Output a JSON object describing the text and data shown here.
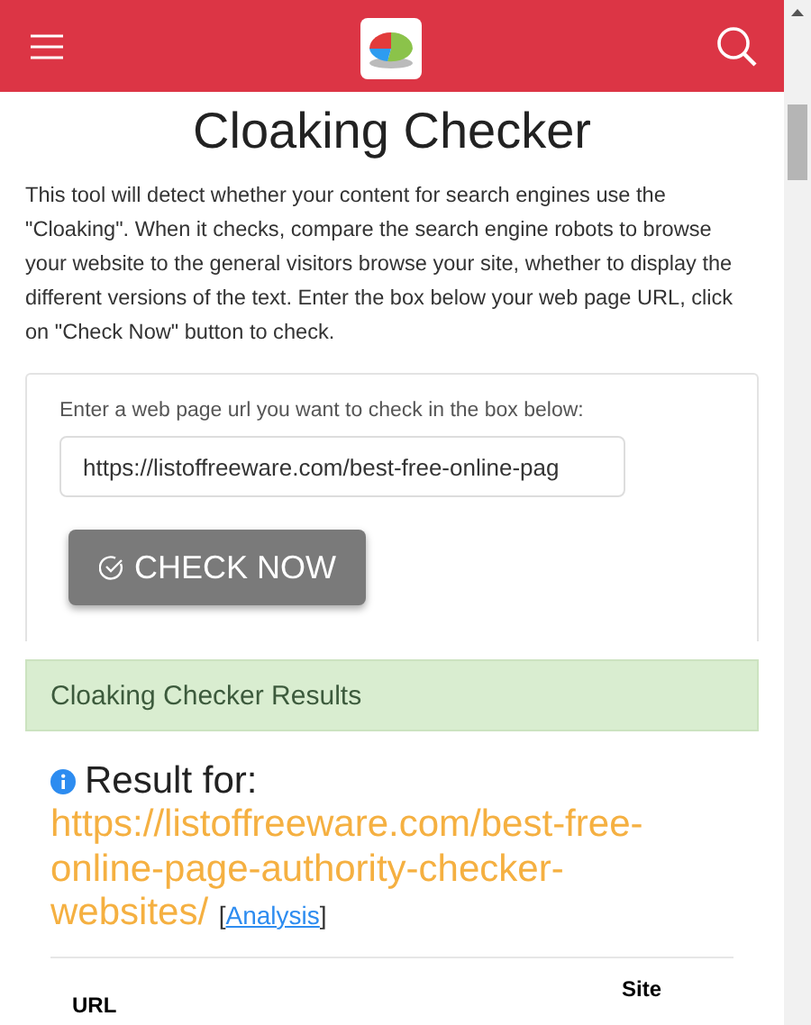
{
  "page_title": "Cloaking Checker",
  "intro": "This tool will detect whether your content for search engines use the \"Cloaking\". When it checks, compare the search engine robots to browse your website to the general visitors browse your site, whether to display the different versions of the text. Enter the box below your web page URL, click on \"Check Now\" button to check.",
  "form": {
    "label": "Enter a web page url you want to check in the box below:",
    "url_value": "https://listoffreeware.com/best-free-online-pag",
    "button": "CHECK NOW"
  },
  "results": {
    "heading": "Cloaking Checker Results",
    "result_for": "Result for:",
    "url": "https://listoffreeware.com/best-free-online-page-authority-checker-websites/",
    "open_bracket": "[",
    "link": "Analysis",
    "close_bracket": "]",
    "table": {
      "columns": [
        "URL",
        "Site"
      ]
    }
  }
}
